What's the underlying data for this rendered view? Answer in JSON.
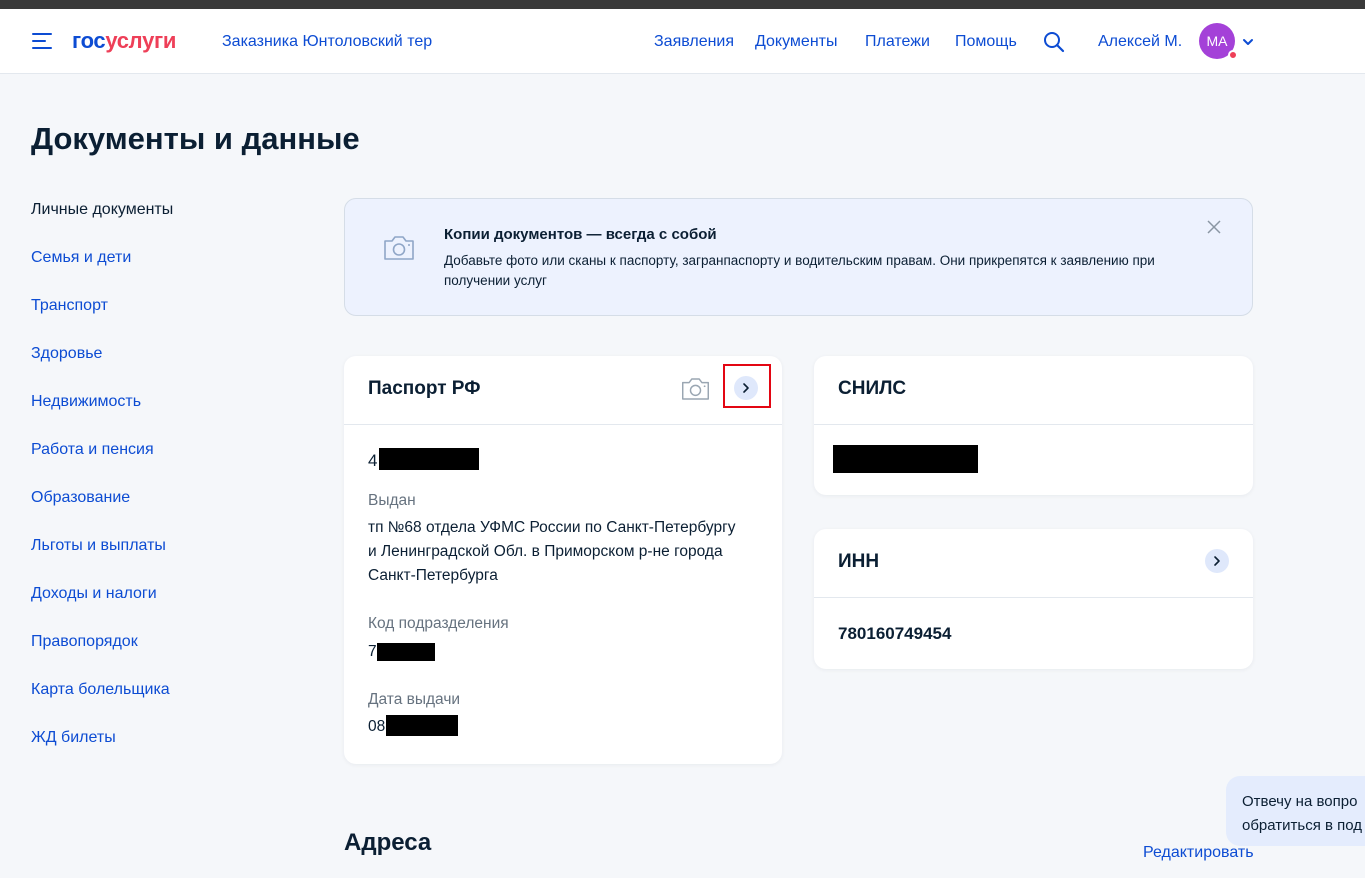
{
  "header": {
    "logo_part1": "гос",
    "logo_part2": "услуги",
    "location": "Заказника Юнтоловский тер",
    "nav": [
      "Заявления",
      "Документы",
      "Платежи",
      "Помощь"
    ],
    "user_name": "Алексей М.",
    "avatar_initials": "МА"
  },
  "page": {
    "title": "Документы и данные"
  },
  "sidebar": {
    "items": [
      "Личные документы",
      "Семья и дети",
      "Транспорт",
      "Здоровье",
      "Недвижимость",
      "Работа и пенсия",
      "Образование",
      "Льготы и выплаты",
      "Доходы и налоги",
      "Правопорядок",
      "Карта болельщика",
      "ЖД билеты"
    ],
    "active_index": 0
  },
  "banner": {
    "title": "Копии документов — всегда с собой",
    "text": "Добавьте фото или сканы к паспорту, загранпаспорту и водительским правам. Они прикрепятся к заявлению при получении услуг"
  },
  "passport": {
    "title": "Паспорт РФ",
    "number_prefix": "4",
    "issued_label": "Выдан",
    "issued_by": [
      "тп №68 отдела УФМС России по Санкт-Петербургу",
      "и Ленинградской Обл. в Приморском р-не города",
      "Санкт-Петербурга"
    ],
    "dept_code_label": "Код подразделения",
    "dept_code_prefix": "7",
    "issue_date_label": "Дата выдачи",
    "issue_date_prefix": "08"
  },
  "snils": {
    "title": "СНИЛС"
  },
  "inn": {
    "title": "ИНН",
    "value": "780160749454"
  },
  "addresses": {
    "title": "Адреса",
    "edit_label": "Редактировать"
  },
  "chat": {
    "lines": [
      "Отвечу на вопро",
      "обратиться в под"
    ]
  },
  "colors": {
    "brand_blue": "#0d4cd3",
    "brand_red": "#ee3f58",
    "avatar": "#a441d8",
    "highlight": "#e30613"
  }
}
